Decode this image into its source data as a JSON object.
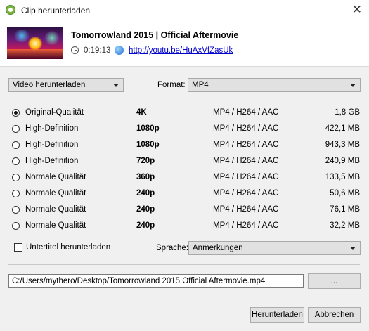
{
  "window": {
    "title": "Clip herunterladen"
  },
  "video": {
    "title": "Tomorrowland 2015 | Official Aftermovie",
    "duration": "0:19:13",
    "link": "http://youtu.be/HuAxVfZasUk"
  },
  "controls": {
    "mode_select": "Video herunterladen",
    "format_label": "Format:",
    "format_value": "MP4"
  },
  "qualities": [
    {
      "label": "Original-Qualität",
      "res": "4K",
      "codec": "MP4 / H264 / AAC",
      "size": "1,8 GB"
    },
    {
      "label": "High-Definition",
      "res": "1080p",
      "codec": "MP4 / H264 / AAC",
      "size": "422,1 MB"
    },
    {
      "label": "High-Definition",
      "res": "1080p",
      "codec": "MP4 / H264 / AAC",
      "size": "943,3 MB"
    },
    {
      "label": "High-Definition",
      "res": "720p",
      "codec": "MP4 / H264 / AAC",
      "size": "240,9 MB"
    },
    {
      "label": "Normale Qualität",
      "res": "360p",
      "codec": "MP4 / H264 / AAC",
      "size": "133,5 MB"
    },
    {
      "label": "Normale Qualität",
      "res": "240p",
      "codec": "MP4 / H264 / AAC",
      "size": "50,6 MB"
    },
    {
      "label": "Normale Qualität",
      "res": "240p",
      "codec": "MP4 / H264 / AAC",
      "size": "76,1 MB"
    },
    {
      "label": "Normale Qualität",
      "res": "240p",
      "codec": "MP4 / H264 / AAC",
      "size": "32,2 MB"
    }
  ],
  "selected_quality_index": 0,
  "subtitles": {
    "label": "Untertitel herunterladen",
    "checked": false,
    "lang_label": "Sprache:",
    "lang_value": "Anmerkungen"
  },
  "output": {
    "path": "C:/Users/mythero/Desktop/Tomorrowland 2015   Official Aftermovie.mp4",
    "browse_label": "..."
  },
  "buttons": {
    "download": "Herunterladen",
    "cancel": "Abbrechen"
  }
}
